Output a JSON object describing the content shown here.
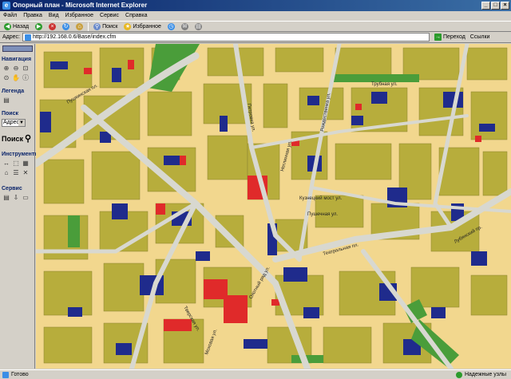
{
  "window": {
    "title": "Опорный план - Microsoft Internet Explorer"
  },
  "menu": [
    "Файл",
    "Правка",
    "Вид",
    "Избранное",
    "Сервис",
    "Справка"
  ],
  "toolbar": {
    "back": "Назад",
    "search": "Поиск",
    "favorites": "Избранное"
  },
  "address": {
    "label": "Адрес:",
    "url": "http://192.168.0.6/Base/index.cfm",
    "go": "Переход",
    "links": "Ссылки"
  },
  "sidebar": {
    "navigation": "Навигация",
    "legend": "Легенда",
    "search_title": "Поиск",
    "search_select": "Адрес",
    "search_button": "Поиск",
    "tools": "Инструменты",
    "services": "Сервис"
  },
  "map": {
    "streets": [
      "Пушкинская пл.",
      "Тверская ул.",
      "Кузнецкий мост ул.",
      "Театральная пл.",
      "Охотный ряд ул.",
      "Петровка ул.",
      "Неглинная ул.",
      "Рождественка ул.",
      "Пушечная ул.",
      "Моховая ул.",
      "Трубная ул.",
      "Лубянский пр."
    ]
  },
  "status": {
    "text": "Готово",
    "zone": "Надежные узлы"
  }
}
